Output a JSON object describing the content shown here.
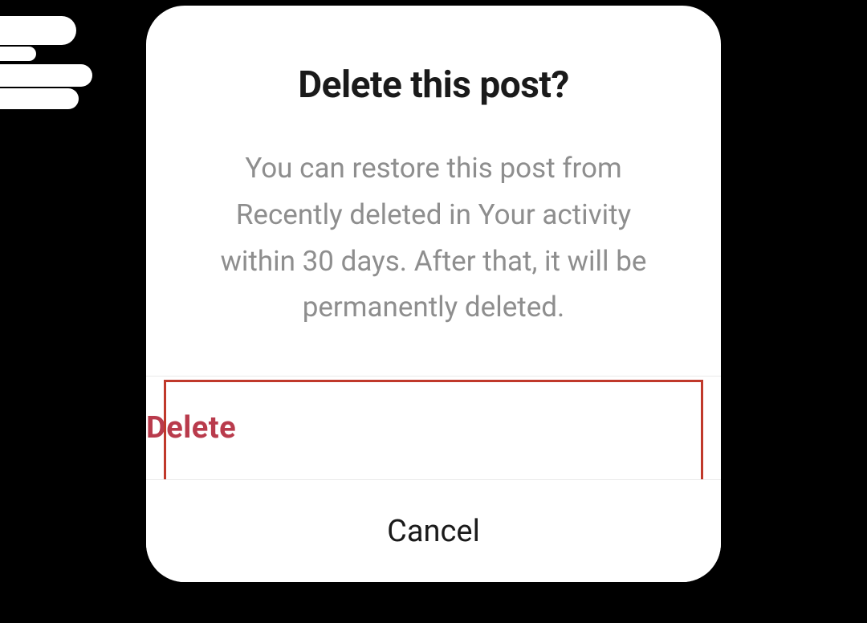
{
  "dialog": {
    "title": "Delete this post?",
    "message": "You can restore this post from Recently deleted in Your activ­ity within 30 days. After that, it will be permanently deleted.",
    "actions": {
      "delete_label": "Delete",
      "cancel_label": "Cancel"
    }
  }
}
